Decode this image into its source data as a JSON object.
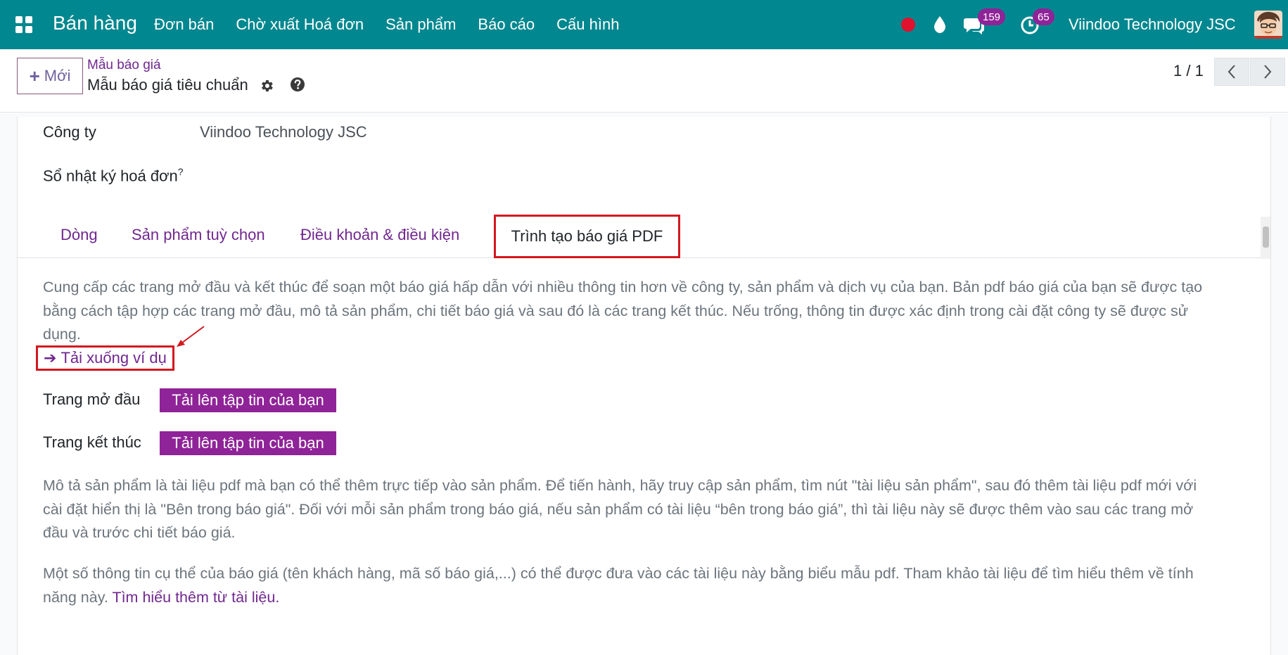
{
  "colors": {
    "navbar": "#00878f",
    "accent": "#71278f",
    "button": "#8f2398",
    "highlight": "#d3181f",
    "record_dot": "#e0122d",
    "badge": "#8f2398"
  },
  "navbar": {
    "app_title": "Bán hàng",
    "menu": [
      "Đơn bán",
      "Chờ xuất Hoá đơn",
      "Sản phẩm",
      "Báo cáo",
      "Cấu hình"
    ],
    "messages_count": "159",
    "activities_count": "65",
    "company": "Viindoo Technology JSC",
    "icons": [
      "apps-icon",
      "record-dot-icon",
      "drop-icon",
      "chat-icon",
      "clock-icon",
      "avatar"
    ]
  },
  "control_panel": {
    "new_button": "Mới",
    "breadcrumb": "Mẫu báo giá",
    "record_title": "Mẫu báo giá tiêu chuẩn",
    "pager": "1 / 1"
  },
  "form": {
    "company_label": "Công ty",
    "company_value": "Viindoo Technology JSC",
    "journal_label": "Sổ nhật ký hoá đơn",
    "journal_help": "?"
  },
  "tabs": [
    "Dòng",
    "Sản phẩm tuỳ chọn",
    "Điều khoản & điều kiện",
    "Trình tạo báo giá PDF"
  ],
  "pdf_builder": {
    "intro_line1": "Cung cấp các trang mở đầu và kết thúc để soạn một báo giá hấp dẫn với nhiều thông tin hơn về công ty, sản phẩm và dịch vụ của bạn. Bản pdf báo giá của bạn sẽ được tạo",
    "intro_line2": "bằng cách tập hợp các trang mở đầu, mô tả sản phẩm, chi tiết báo giá và sau đó là các trang kết thúc. Nếu trống, thông tin được xác định trong cài đặt công ty sẽ được sử",
    "intro_line3": "dụng.",
    "download_example": "Tải xuống ví dụ",
    "header_pages_label": "Trang mở đầu",
    "footer_pages_label": "Trang kết thúc",
    "upload_button": "Tải lên tập tin của bạn",
    "product_doc_line1": "Mô tả sản phẩm là tài liệu pdf mà bạn có thể thêm trực tiếp vào sản phẩm. Để tiến hành, hãy truy cập sản phẩm, tìm nút \"tài liệu sản phẩm\", sau đó thêm tài liệu pdf mới với",
    "product_doc_line2": "cài đặt hiển thị là \"Bên trong báo giá\". Đối với mỗi sản phẩm trong báo giá, nếu sản phẩm có tài liệu “bên trong báo giá”, thì tài liệu này sẽ được thêm vào sau các trang mở",
    "product_doc_line3": "đầu và trước chi tiết báo giá.",
    "form_fields_line1": "Một số thông tin cụ thể của báo giá (tên khách hàng, mã số báo giá,...) có thể được đưa vào các tài liệu này bằng biểu mẫu pdf. Tham khảo tài liệu để tìm hiểu thêm về tính",
    "form_fields_line2": "năng này.",
    "learn_more": "Tìm hiểu thêm từ tài liệu."
  }
}
